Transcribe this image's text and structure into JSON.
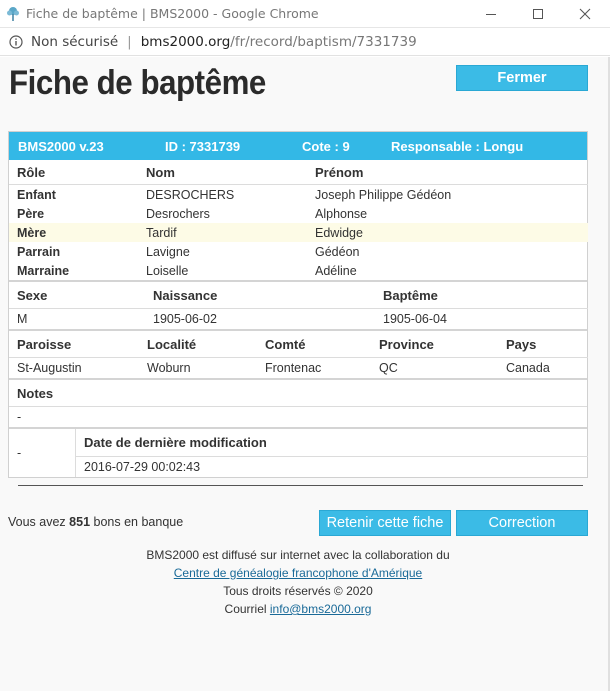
{
  "window": {
    "title": "Fiche de baptême | BMS2000 - Google Chrome",
    "minimize_glyph": "—",
    "maximize_glyph": "☐",
    "close_glyph": "✕"
  },
  "address_bar": {
    "security_label": "Non sécurisé",
    "separator": "|",
    "url_host": "bms2000.org",
    "url_path": "/fr/record/baptism/7331739"
  },
  "page": {
    "title": "Fiche de baptême",
    "close_button": "Fermer"
  },
  "record_header": {
    "version": "BMS2000 v.23",
    "id": "ID : 7331739",
    "cote": "Cote : 9",
    "responsable": "Responsable : Longu"
  },
  "roles_table": {
    "headers": [
      "Rôle",
      "Nom",
      "Prénom"
    ],
    "rows": [
      {
        "role": "Enfant",
        "nom": "DESROCHERS",
        "prenom": "Joseph Philippe Gédéon"
      },
      {
        "role": "Père",
        "nom": "Desrochers",
        "prenom": "Alphonse"
      },
      {
        "role": "Mère",
        "nom": "Tardif",
        "prenom": "Edwidge"
      },
      {
        "role": "Parrain",
        "nom": "Lavigne",
        "prenom": "Gédéon"
      },
      {
        "role": "Marraine",
        "nom": "Loiselle",
        "prenom": "Adéline"
      }
    ]
  },
  "dates_table": {
    "headers": [
      "Sexe",
      "Naissance",
      "Baptême"
    ],
    "values": [
      "M",
      "1905-06-02",
      "1905-06-04"
    ]
  },
  "places_table": {
    "headers": [
      "Paroisse",
      "Localité",
      "Comté",
      "Province",
      "Pays"
    ],
    "values": [
      "St-Augustin",
      "Woburn",
      "Frontenac",
      "QC",
      "Canada"
    ]
  },
  "notes": {
    "header": "Notes",
    "value": "-"
  },
  "last_modified": {
    "left_value": "-",
    "header": "Date de dernière modification",
    "value": "2016-07-29 00:02:43"
  },
  "bank": {
    "prefix": "Vous avez",
    "count": "851",
    "suffix": "bons en banque"
  },
  "buttons": {
    "retain": "Retenir cette fiche",
    "correction": "Correction"
  },
  "footer": {
    "line1": "BMS2000 est diffusé sur internet avec la collaboration du",
    "link": "Centre de généalogie francophone d'Amérique",
    "rights": "Tous droits réservés © 2020",
    "mail_prefix": "Courriel",
    "mail": "info@bms2000.org"
  },
  "colors": {
    "accent": "#33b8e6",
    "button": "#3bbbe6",
    "highlight_row": "#fdfbe6",
    "link": "#1a6a98"
  }
}
